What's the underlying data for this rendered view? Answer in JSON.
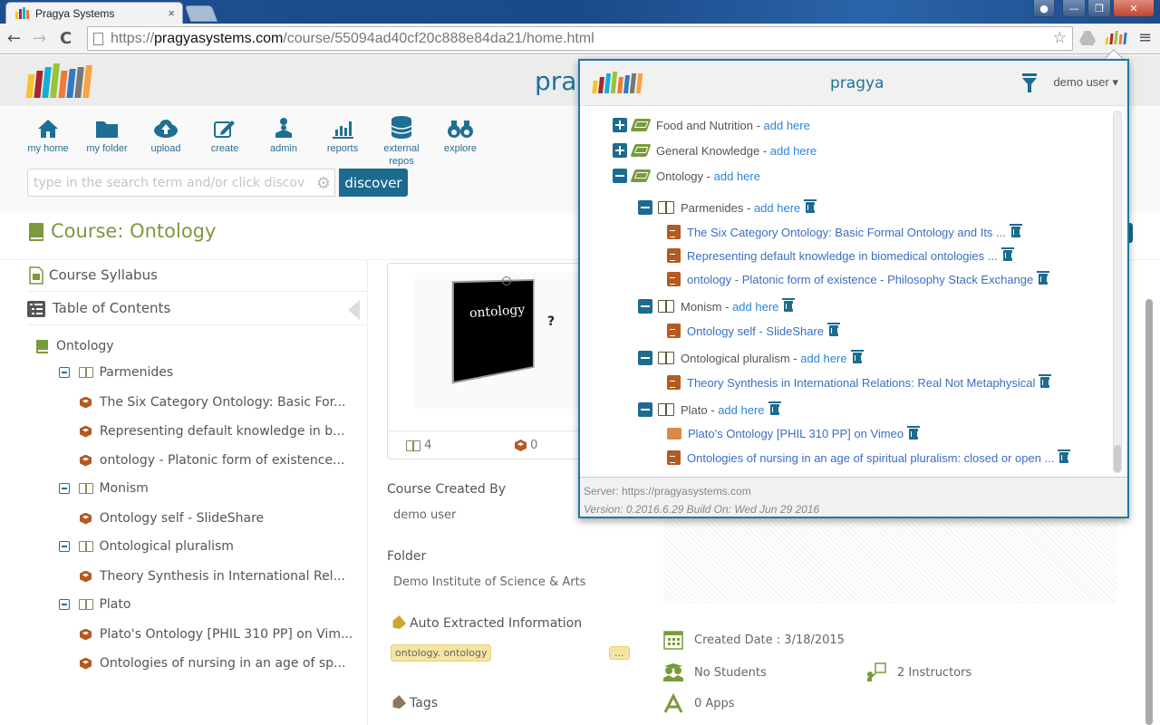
{
  "browser": {
    "tab_title": "Pragya Systems",
    "tab_close": "×",
    "url_prefix": "https://",
    "url_host": "pragyasystems.com",
    "url_path": "/course/55094ad40cf20c888e84da21/home.html",
    "nav": {
      "back": "←",
      "forward": "→",
      "reload": "C"
    }
  },
  "app": {
    "brand": "pragya",
    "nav_items": [
      {
        "label": "my home",
        "icon": "home-icon"
      },
      {
        "label": "my folder",
        "icon": "folder-icon"
      },
      {
        "label": "upload",
        "icon": "cloud-upload-icon"
      },
      {
        "label": "create",
        "icon": "edit-icon"
      },
      {
        "label": "admin",
        "icon": "admin-icon"
      },
      {
        "label": "reports",
        "icon": "bar-chart-icon"
      },
      {
        "label": "external repos",
        "icon": "database-icon"
      },
      {
        "label": "explore",
        "icon": "binoculars-icon"
      }
    ],
    "search": {
      "placeholder": "type in the search term and/or click discover...",
      "value": ""
    },
    "discover_label": "discover",
    "logo_colors": [
      "#f7c22b",
      "#a8262e",
      "#12b0d8",
      "#9ac33c",
      "#ef7a36",
      "#2f7cc4",
      "#777777",
      "#f6a43f"
    ]
  },
  "course": {
    "title_prefix": "Course:",
    "title": "Ontology",
    "syllabus_label": "Course Syllabus",
    "toc_label": "Table of Contents",
    "toc": {
      "root": "Ontology",
      "units": [
        {
          "name": "Parmenides",
          "items": [
            "The Six Category Ontology: Basic For...",
            "Representing default knowledge in b...",
            "ontology - Platonic form of existence..."
          ]
        },
        {
          "name": "Monism",
          "items": [
            "Ontology self - SlideShare"
          ]
        },
        {
          "name": "Ontological pluralism",
          "items": [
            "Theory Synthesis in International Rel..."
          ]
        },
        {
          "name": "Plato",
          "items": [
            "Plato's Ontology [PHIL 310 PP] on Vim...",
            "Ontologies of nursing in an age of sp..."
          ]
        }
      ]
    },
    "card": {
      "image_text": "ontology",
      "units_count": "4",
      "resources_count": "0"
    },
    "created_by_label": "Course Created By",
    "created_by": "demo user",
    "folder_label": "Folder",
    "folder": "Demo Institute of Science & Arts",
    "auto_extracted_label": "Auto Extracted Information",
    "auto_extracted_chip": "ontology. ontology",
    "more_label": "...",
    "tags_label": "Tags",
    "created_date": "Created Date : 3/18/2015",
    "students": "No Students",
    "instructors": "2 Instructors",
    "apps": "0 Apps"
  },
  "popup": {
    "brand": "pragya",
    "user": "demo user",
    "add_here": "add here",
    "folders": [
      {
        "name": "Food and Nutrition",
        "expanded": false
      },
      {
        "name": "General Knowledge",
        "expanded": false
      },
      {
        "name": "Ontology",
        "expanded": true
      }
    ],
    "units": [
      {
        "name": "Parmenides",
        "resources": [
          {
            "title": "The Six Category Ontology: Basic Formal Ontology and Its ...",
            "type": "document"
          },
          {
            "title": "Representing default knowledge in biomedical ontologies ...",
            "type": "document"
          },
          {
            "title": "ontology - Platonic form of existence - Philosophy Stack Exchange",
            "type": "document"
          }
        ]
      },
      {
        "name": "Monism",
        "resources": [
          {
            "title": "Ontology self - SlideShare",
            "type": "document"
          }
        ]
      },
      {
        "name": "Ontological pluralism",
        "resources": [
          {
            "title": "Theory Synthesis in International Relations: Real Not Metaphysical",
            "type": "document"
          }
        ]
      },
      {
        "name": "Plato",
        "resources": [
          {
            "title": "Plato's Ontology [PHIL 310 PP] on Vimeo",
            "type": "video"
          },
          {
            "title": "Ontologies of nursing in an age of spiritual pluralism: closed or open ...",
            "type": "document"
          }
        ]
      }
    ],
    "server": "Server: https://pragyasystems.com",
    "version": "Version: 0.2016.6.29 Build On: Wed Jun 29 2016"
  }
}
